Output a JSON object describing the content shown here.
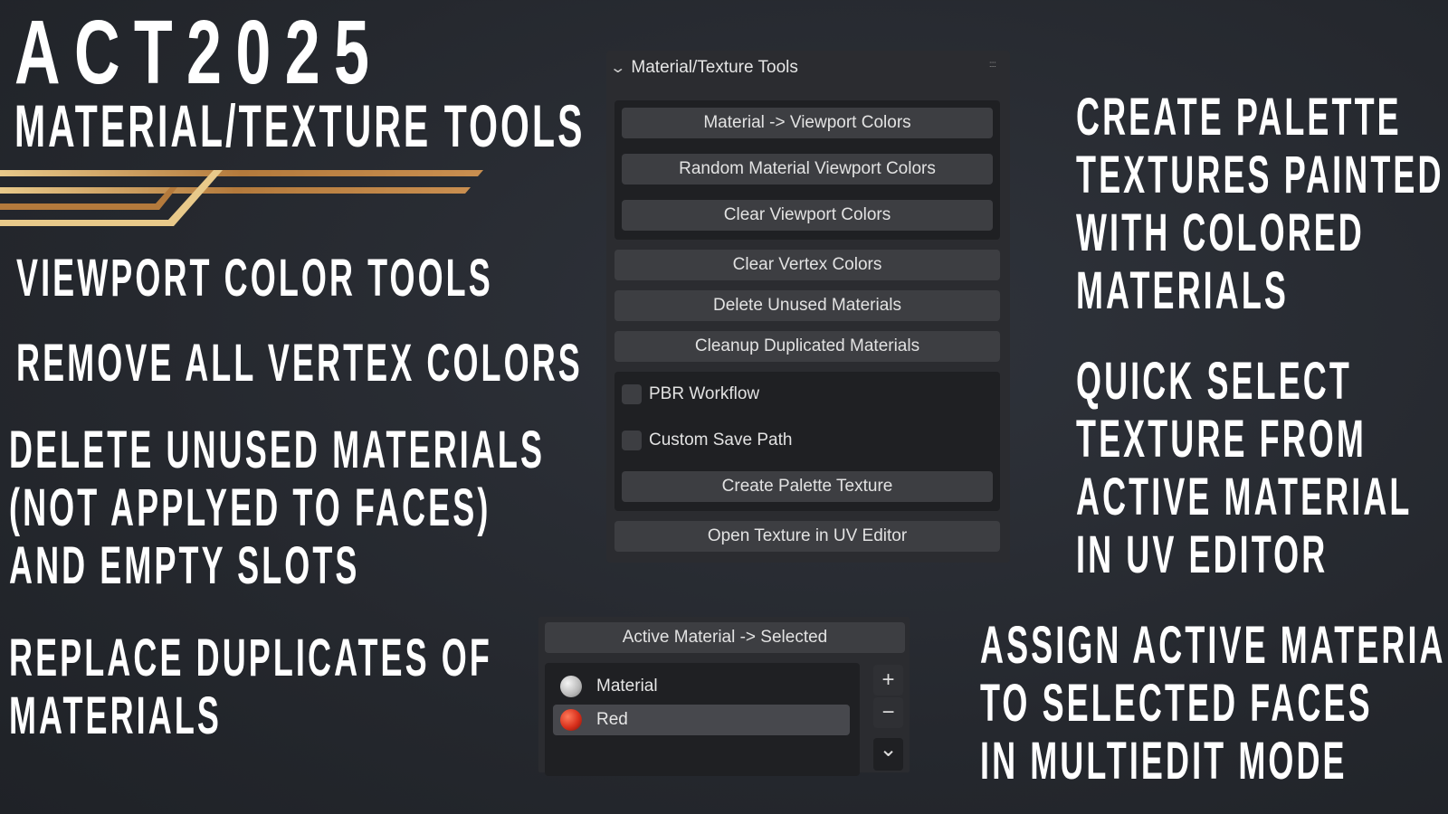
{
  "title": {
    "line1": "ACT2025",
    "line2": "MATERIAL/TEXTURE TOOLS"
  },
  "left_features": [
    [
      "VIEWPORT COLOR TOOLS"
    ],
    [
      "REMOVE ALL VERTEX COLORS"
    ],
    [
      "DELETE UNUSED MATERIALS",
      "(NOT APPLYED TO FACES)",
      "AND EMPTY SLOTS"
    ],
    [
      "REPLACE DUPLICATES OF",
      "MATERIALS"
    ]
  ],
  "right_features": [
    [
      "CREATE PALETTE",
      "TEXTURES PAINTED",
      "WITH COLORED",
      "MATERIALS"
    ],
    [
      "QUICK SELECT",
      "TEXTURE FROM",
      "ACTIVE MATERIAL",
      "IN UV EDITOR"
    ],
    [
      "ASSIGN ACTIVE MATERIAL",
      "TO SELECTED FACES",
      "IN MULTIEDIT MODE"
    ]
  ],
  "panel": {
    "header": "Material/Texture Tools",
    "viewport_buttons": [
      "Material -> Viewport Colors",
      "Random Material Viewport Colors",
      "Clear Viewport Colors"
    ],
    "buttons": [
      "Clear Vertex Colors",
      "Delete Unused Materials",
      "Cleanup Duplicated Materials"
    ],
    "checkboxes": [
      {
        "label": "PBR Workflow",
        "checked": false
      },
      {
        "label": "Custom Save Path",
        "checked": false
      }
    ],
    "palette_button": "Create Palette Texture",
    "open_uv_button": "Open Texture in UV Editor"
  },
  "material_panel": {
    "assign_button": "Active Material -> Selected",
    "slots": [
      {
        "name": "Material",
        "color": "#d0d0d0",
        "selected": false
      },
      {
        "name": "Red",
        "color": "#d8301c",
        "selected": true
      }
    ],
    "add_label": "+",
    "remove_label": "−",
    "menu_label": "⌄"
  },
  "colors": {
    "gold": "#d9b26a",
    "bronze": "#b47a3c"
  }
}
